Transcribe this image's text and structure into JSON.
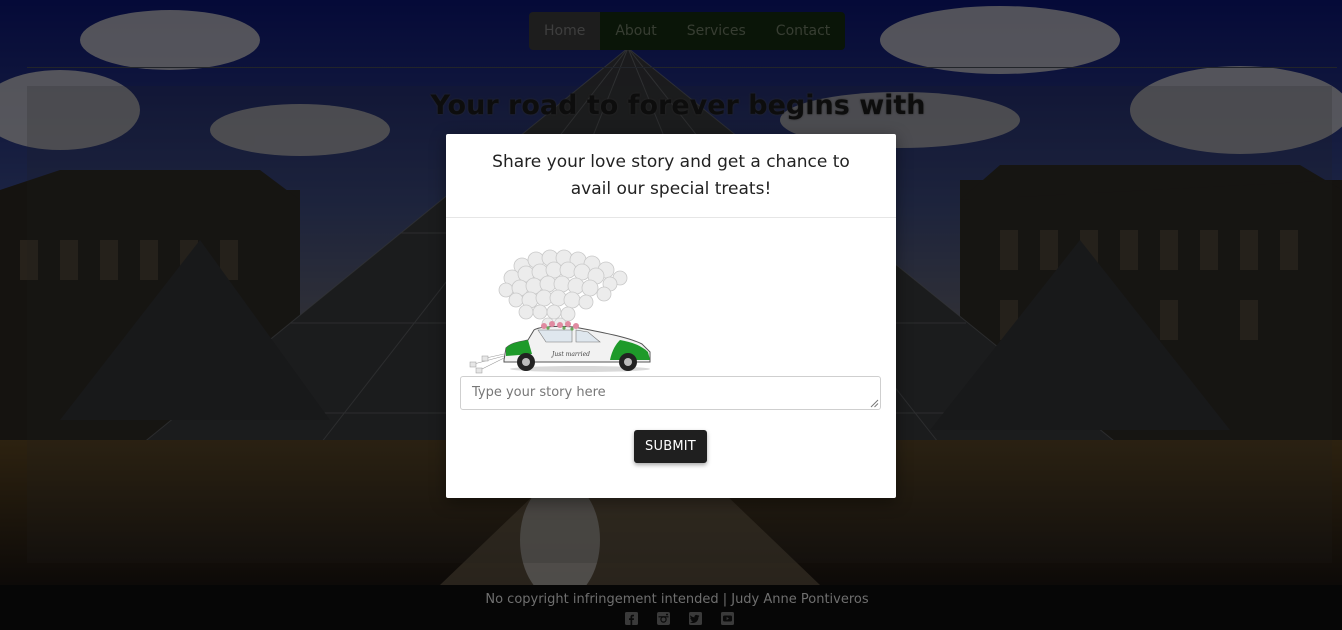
{
  "nav": {
    "items": [
      {
        "label": "Home",
        "active": true
      },
      {
        "label": "About",
        "active": false
      },
      {
        "label": "Services",
        "active": false
      },
      {
        "label": "Contact",
        "active": false
      }
    ]
  },
  "hero": {
    "title_pre": "Your road to ",
    "title_bold": "forever",
    "title_post": " begins with"
  },
  "modal": {
    "title": "Share your love story and get a chance to avail our special treats!",
    "story_placeholder": "Type your story here",
    "submit_label": "SUBMIT",
    "car_plate_text": "Just married"
  },
  "footer": {
    "text": "No copyright infringement intended | Judy Anne Pontiveros",
    "social_icons": [
      "facebook-icon",
      "instagram-icon",
      "twitter-icon",
      "youtube-icon"
    ]
  },
  "colors": {
    "nav_bg": "#142a10",
    "nav_active_bg": "#3a3a3a",
    "submit_bg": "#1f1f1f",
    "car_green": "#1e9a2a"
  }
}
